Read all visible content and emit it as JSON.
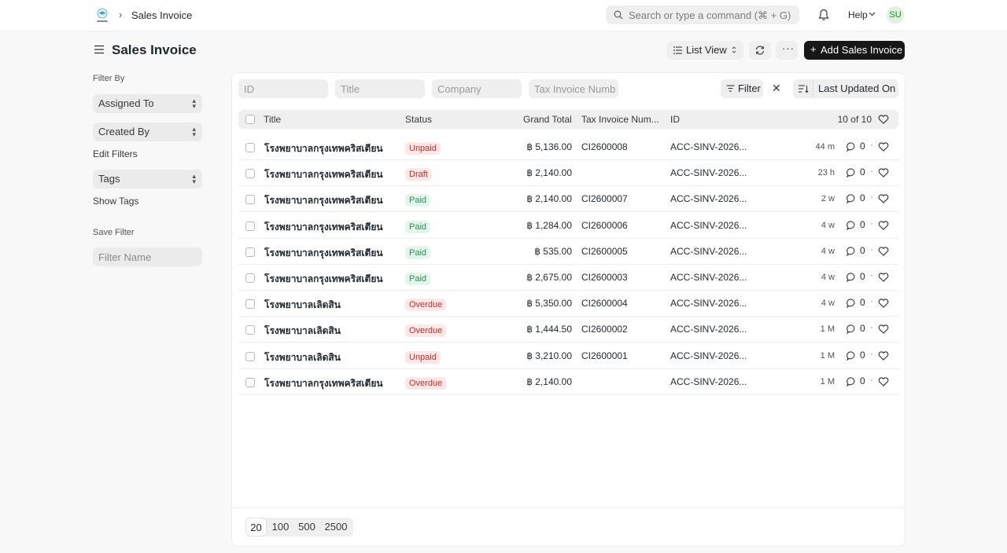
{
  "navbar": {
    "breadcrumb": "Sales Invoice",
    "search_placeholder": "Search or type a command (⌘ + G)",
    "help_label": "Help",
    "avatar_initials": "SU"
  },
  "page": {
    "title": "Sales Invoice",
    "list_view_label": "List View",
    "more_label": "···",
    "add_label": "Add Sales Invoice"
  },
  "sidebar": {
    "filter_by_label": "Filter By",
    "assigned_to": "Assigned To",
    "created_by": "Created By",
    "edit_filters": "Edit Filters",
    "tags": "Tags",
    "show_tags": "Show Tags",
    "save_filter_label": "Save Filter",
    "filter_name_placeholder": "Filter Name"
  },
  "filters": {
    "id_placeholder": "ID",
    "title_placeholder": "Title",
    "company_placeholder": "Company",
    "tax_placeholder": "Tax Invoice Numb",
    "filter_label": "Filter",
    "clear_label": "✕",
    "sort_label": "Last Updated On"
  },
  "table": {
    "headers": {
      "title": "Title",
      "status": "Status",
      "grand_total": "Grand Total",
      "tax_invoice": "Tax Invoice Num...",
      "id": "ID",
      "count": "10 of 10"
    },
    "rows": [
      {
        "title": "โรงพยาบาลกรุงเทพคริสเตียน",
        "status": "Unpaid",
        "status_color": "red",
        "total": "฿ 5,136.00",
        "tax": "CI2600008",
        "id": "ACC-SINV-2026...",
        "time": "44 m",
        "comments": "0"
      },
      {
        "title": "โรงพยาบาลกรุงเทพคริสเตียน",
        "status": "Draft",
        "status_color": "red",
        "total": "฿ 2,140.00",
        "tax": "",
        "id": "ACC-SINV-2026...",
        "time": "23 h",
        "comments": "0"
      },
      {
        "title": "โรงพยาบาลกรุงเทพคริสเตียน",
        "status": "Paid",
        "status_color": "green",
        "total": "฿ 2,140.00",
        "tax": "CI2600007",
        "id": "ACC-SINV-2026...",
        "time": "2 w",
        "comments": "0"
      },
      {
        "title": "โรงพยาบาลกรุงเทพคริสเตียน",
        "status": "Paid",
        "status_color": "green",
        "total": "฿ 1,284.00",
        "tax": "CI2600006",
        "id": "ACC-SINV-2026...",
        "time": "4 w",
        "comments": "0"
      },
      {
        "title": "โรงพยาบาลกรุงเทพคริสเตียน",
        "status": "Paid",
        "status_color": "green",
        "total": "฿ 535.00",
        "tax": "CI2600005",
        "id": "ACC-SINV-2026...",
        "time": "4 w",
        "comments": "0"
      },
      {
        "title": "โรงพยาบาลกรุงเทพคริสเตียน",
        "status": "Paid",
        "status_color": "green",
        "total": "฿ 2,675.00",
        "tax": "CI2600003",
        "id": "ACC-SINV-2026...",
        "time": "4 w",
        "comments": "0"
      },
      {
        "title": "โรงพยาบาลเลิดสิน",
        "status": "Overdue",
        "status_color": "red",
        "total": "฿ 5,350.00",
        "tax": "CI2600004",
        "id": "ACC-SINV-2026...",
        "time": "4 w",
        "comments": "0"
      },
      {
        "title": "โรงพยาบาลเลิดสิน",
        "status": "Overdue",
        "status_color": "red",
        "total": "฿ 1,444.50",
        "tax": "CI2600002",
        "id": "ACC-SINV-2026...",
        "time": "1 M",
        "comments": "0"
      },
      {
        "title": "โรงพยาบาลเลิดสิน",
        "status": "Unpaid",
        "status_color": "red",
        "total": "฿ 3,210.00",
        "tax": "CI2600001",
        "id": "ACC-SINV-2026...",
        "time": "1 M",
        "comments": "0"
      },
      {
        "title": "โรงพยาบาลกรุงเทพคริสเตียน",
        "status": "Overdue",
        "status_color": "red",
        "total": "฿ 2,140.00",
        "tax": "",
        "id": "ACC-SINV-2026...",
        "time": "1 M",
        "comments": "0"
      }
    ]
  },
  "paging": {
    "sizes": [
      "20",
      "100",
      "500",
      "2500"
    ],
    "active": "20"
  },
  "colors": {
    "accent": "#171717",
    "status_red": "#cb2929",
    "status_green": "#278f5e"
  }
}
